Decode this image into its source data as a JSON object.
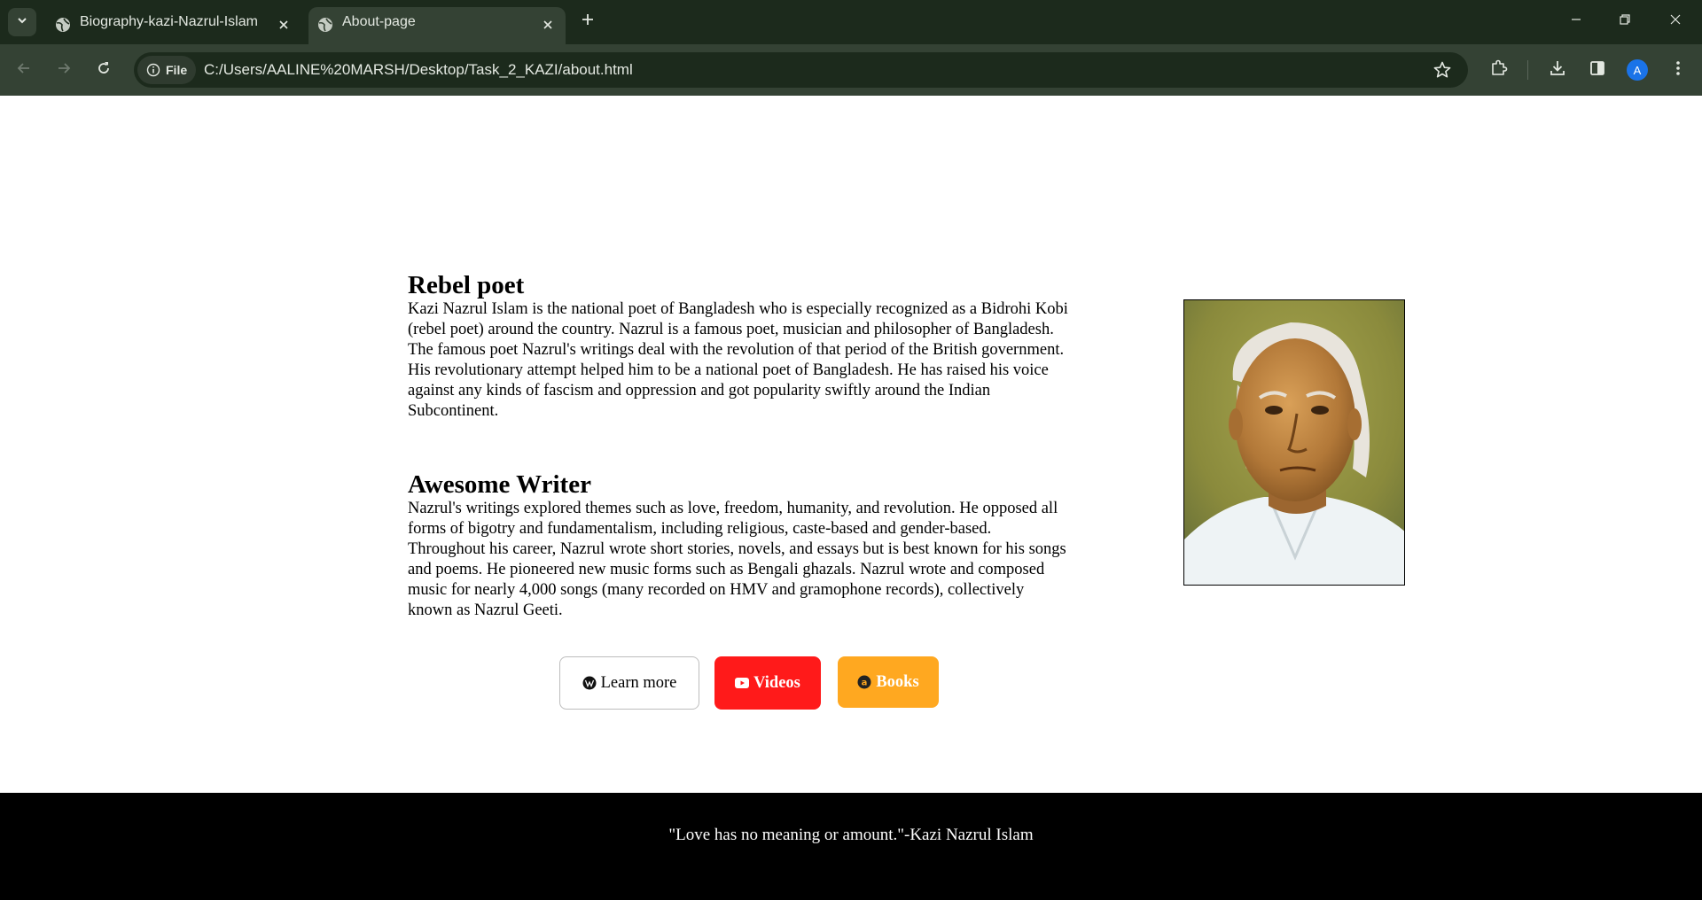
{
  "browser": {
    "tabs": [
      {
        "title": "Biography-kazi-Nazrul-Islam",
        "active": false
      },
      {
        "title": "About-page",
        "active": true
      }
    ],
    "omnibox": {
      "chip_label": "File",
      "url": "C:/Users/AALINE%20MARSH/Desktop/Task_2_KAZI/about.html"
    },
    "profile_initial": "A",
    "colors": {
      "frame": "#1c2a1c",
      "toolbar": "#344234",
      "avatar": "#1a73e8"
    }
  },
  "page": {
    "sections": [
      {
        "heading": "Rebel poet",
        "body": "Kazi Nazrul Islam is the national poet of Bangladesh who is especially recognized as a Bidrohi Kobi (rebel poet) around the country. Nazrul is a famous poet, musician and philosopher of Bangladesh. The famous poet Nazrul's writings deal with the revolution of that period of the British government. His revolutionary attempt helped him to be a national poet of Bangladesh. He has raised his voice against any kinds of fascism and oppression and got popularity swiftly around the Indian Subcontinent."
      },
      {
        "heading": "Awesome Writer",
        "body": "Nazrul's writings explored themes such as love, freedom, humanity, and revolution. He opposed all forms of bigotry and fundamentalism, including religious, caste-based and gender-based. Throughout his career, Nazrul wrote short stories, novels, and essays but is best known for his songs and poems. He pioneered new music forms such as Bengali ghazals. Nazrul wrote and composed music for nearly 4,000 songs (many recorded on HMV and gramophone records), collectively known as Nazrul Geeti."
      }
    ],
    "buttons": {
      "learn_more": {
        "label": "Learn more",
        "icon": "wikipedia-icon"
      },
      "videos": {
        "label": "Videos",
        "icon": "youtube-icon",
        "color": "#ff1a1a"
      },
      "books": {
        "label": "Books",
        "icon": "amazon-icon",
        "color": "#ffa820"
      }
    },
    "footer": {
      "quote": "\"Love has no meaning or amount.\"-Kazi Nazrul Islam"
    }
  }
}
